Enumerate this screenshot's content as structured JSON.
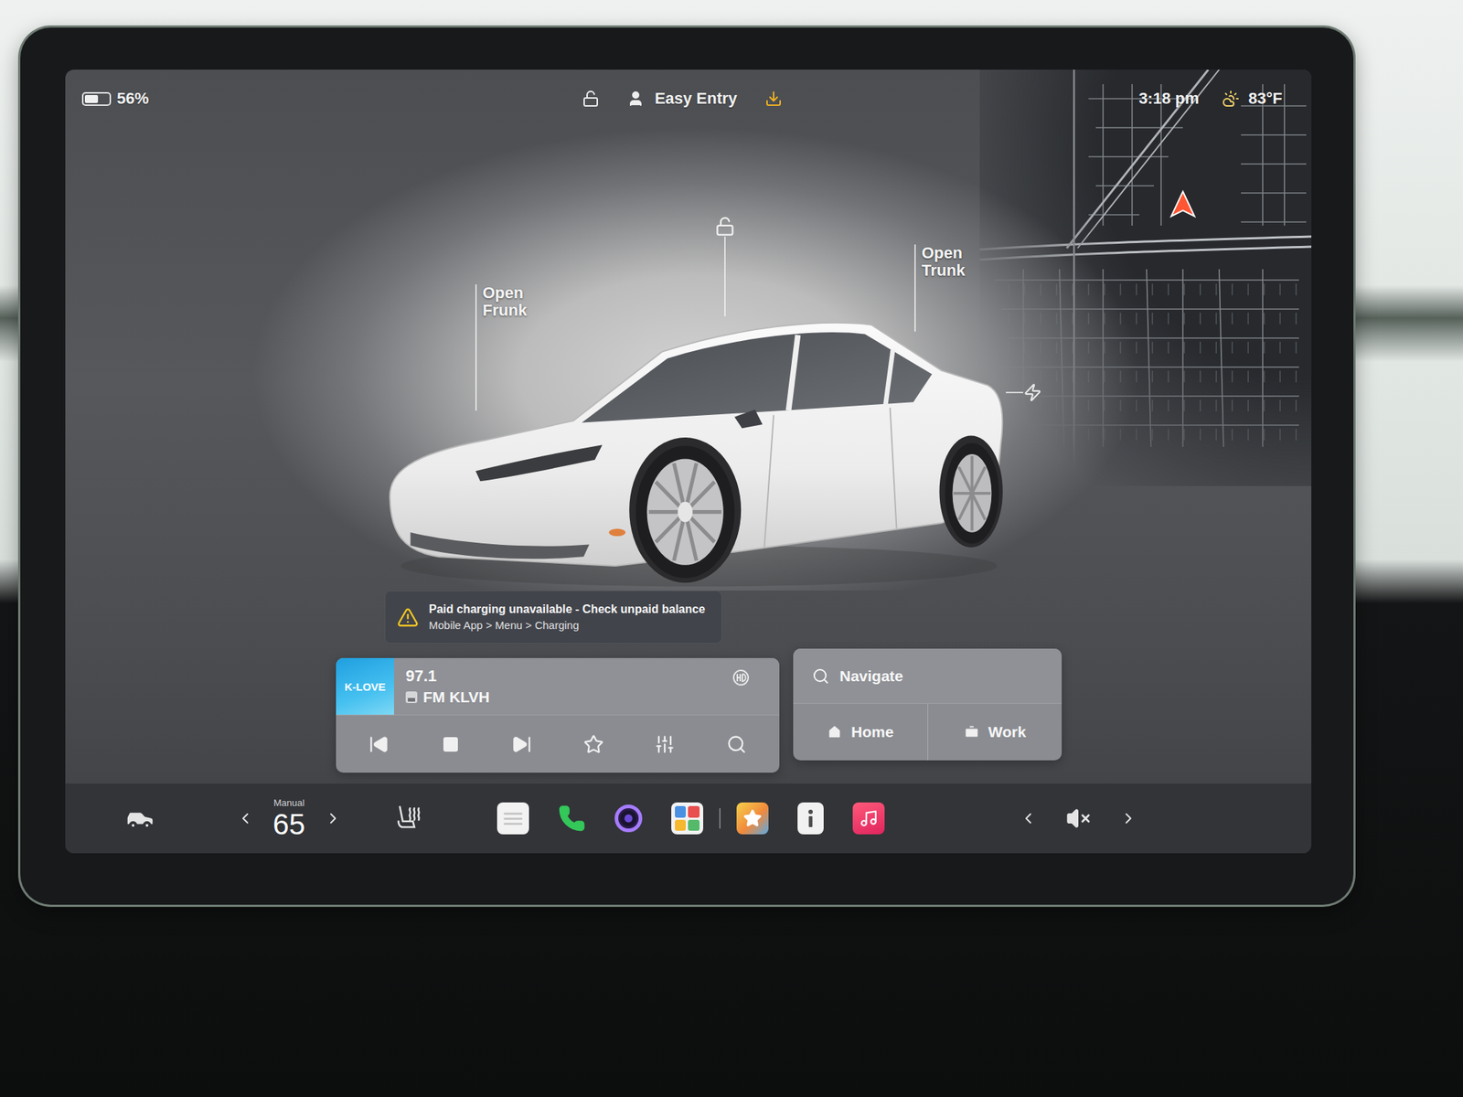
{
  "status_bar": {
    "battery": "56%",
    "battery_level": 0.56,
    "locked": false,
    "profile": "Easy Entry",
    "update_available": true,
    "time": "3:18 pm",
    "temperature": "83°F"
  },
  "car": {
    "locked": false,
    "frunk_label": "Open Frunk",
    "trunk_label": "Open Trunk"
  },
  "alert": {
    "title": "Paid charging unavailable - Check unpaid balance",
    "path": "Mobile App > Menu > Charging"
  },
  "media": {
    "logo": "K-LOVE",
    "frequency": "97.1",
    "station": "FM KLVH"
  },
  "navigation": {
    "placeholder": "Navigate",
    "shortcuts": [
      {
        "label": "Home"
      },
      {
        "label": "Work"
      }
    ]
  },
  "dock": {
    "climate_mode": "Manual",
    "temperature": "65",
    "volume_muted": true
  }
}
